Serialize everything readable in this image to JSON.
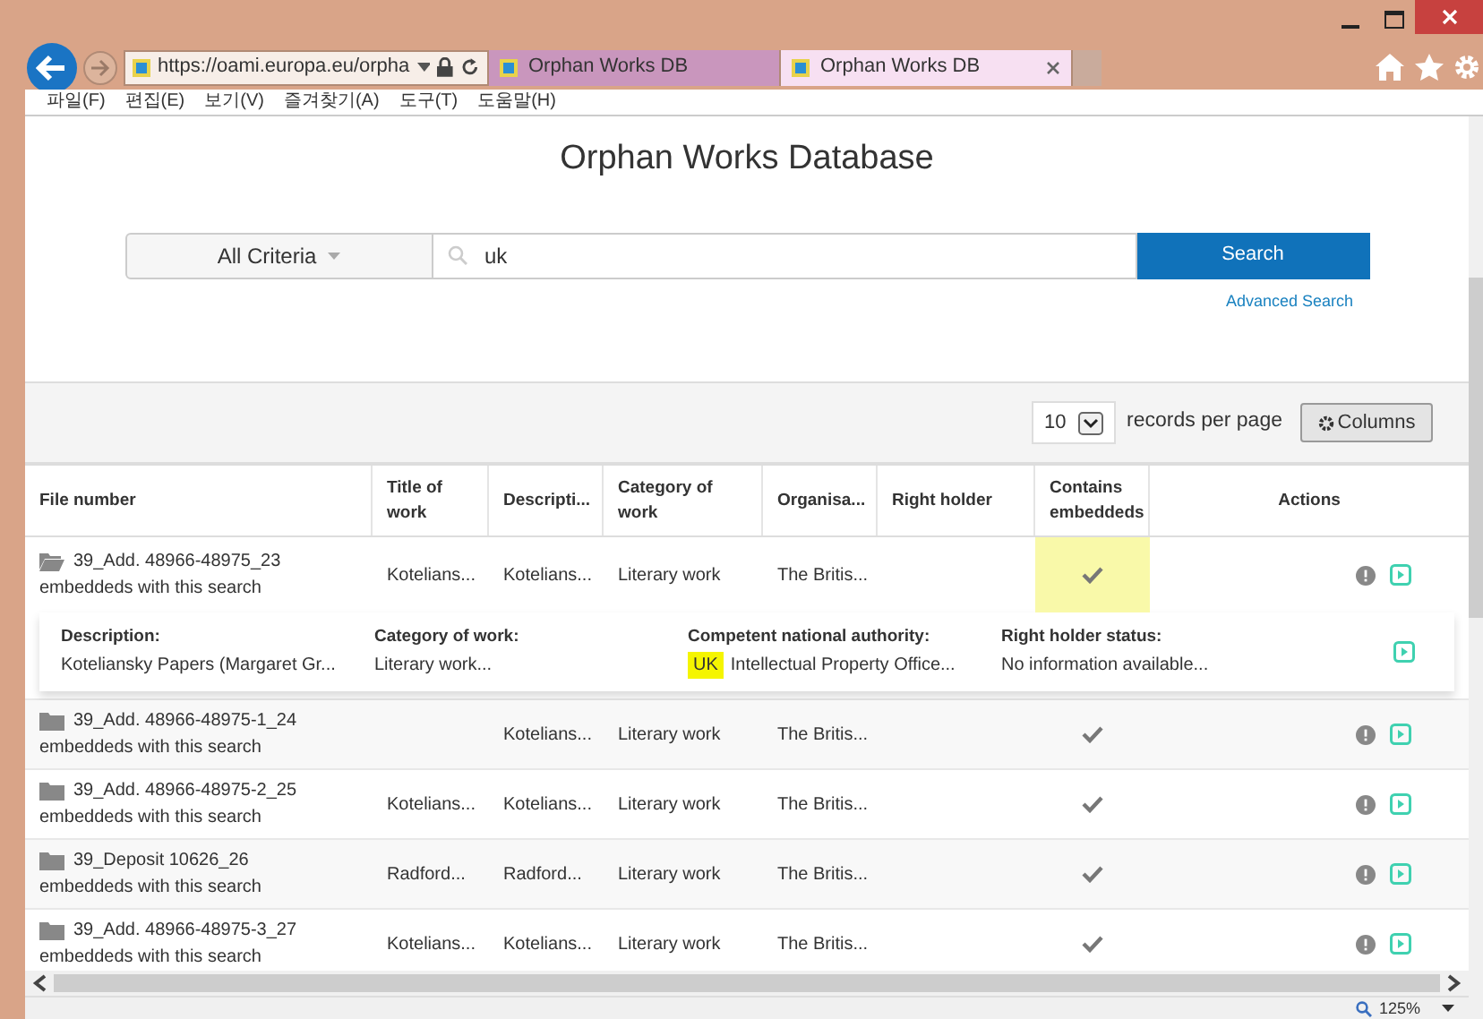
{
  "browser": {
    "url": "https://oami.europa.eu/orpha",
    "tabs": [
      {
        "title": "Orphan Works DB",
        "selected": false
      },
      {
        "title": "Orphan Works DB",
        "selected": true
      }
    ],
    "menu": [
      "파일(F)",
      "편집(E)",
      "보기(V)",
      "즐겨찾기(A)",
      "도구(T)",
      "도움말(H)"
    ],
    "zoom": "125%"
  },
  "page": {
    "title": "Orphan Works Database",
    "criteria": "All Criteria",
    "search_value": "uk",
    "search_button": "Search",
    "advanced_link": "Advanced Search",
    "page_size": "10",
    "records_label": "records per page",
    "columns_button": "Columns"
  },
  "table": {
    "columns": [
      "File number",
      "Title of work",
      "Descripti...",
      "Category of work",
      "Organisa...",
      "Right holder",
      "Contains embeddeds",
      "Actions"
    ],
    "rows": [
      {
        "file": "39_Add. 48966-48975_23",
        "note": "embeddeds with this search",
        "title": "Kotelians...",
        "description": "Kotelians...",
        "category": "Literary work",
        "organisation": "The Britis...",
        "embedded": true,
        "highlighted": true,
        "expanded": true,
        "detail": [
          {
            "label": "Description:",
            "value": "Koteliansky Papers (Margaret Gr..."
          },
          {
            "label": "Category of work:",
            "value": "Literary work..."
          },
          {
            "label": "Competent national authority:",
            "tag": "UK",
            "value": "Intellectual Property Office..."
          },
          {
            "label": "Right holder status:",
            "value": "No information available..."
          }
        ]
      },
      {
        "file": "39_Add. 48966-48975-1_24",
        "note": "embeddeds with this search",
        "description": "Kotelians...",
        "category": "Literary work",
        "organisation": "The Britis...",
        "embedded": true,
        "highlighted": false,
        "expanded": false
      },
      {
        "file": "39_Add. 48966-48975-2_25",
        "note": "embeddeds with this search",
        "title": "Kotelians...",
        "description": "Kotelians...",
        "category": "Literary work",
        "organisation": "The Britis...",
        "embedded": true,
        "highlighted": false,
        "expanded": false
      },
      {
        "file": "39_Deposit 10626_26",
        "note": "embeddeds with this search",
        "title": "Radford...",
        "description": "Radford...",
        "category": "Literary work",
        "organisation": "The Britis...",
        "embedded": true,
        "highlighted": false,
        "expanded": false
      },
      {
        "file": "39_Add. 48966-48975-3_27",
        "note": "embeddeds with this search",
        "title": "Kotelians...",
        "description": "Kotelians...",
        "category": "Literary work",
        "organisation": "The Britis...",
        "embedded": true,
        "highlighted": false,
        "expanded": false
      }
    ]
  }
}
